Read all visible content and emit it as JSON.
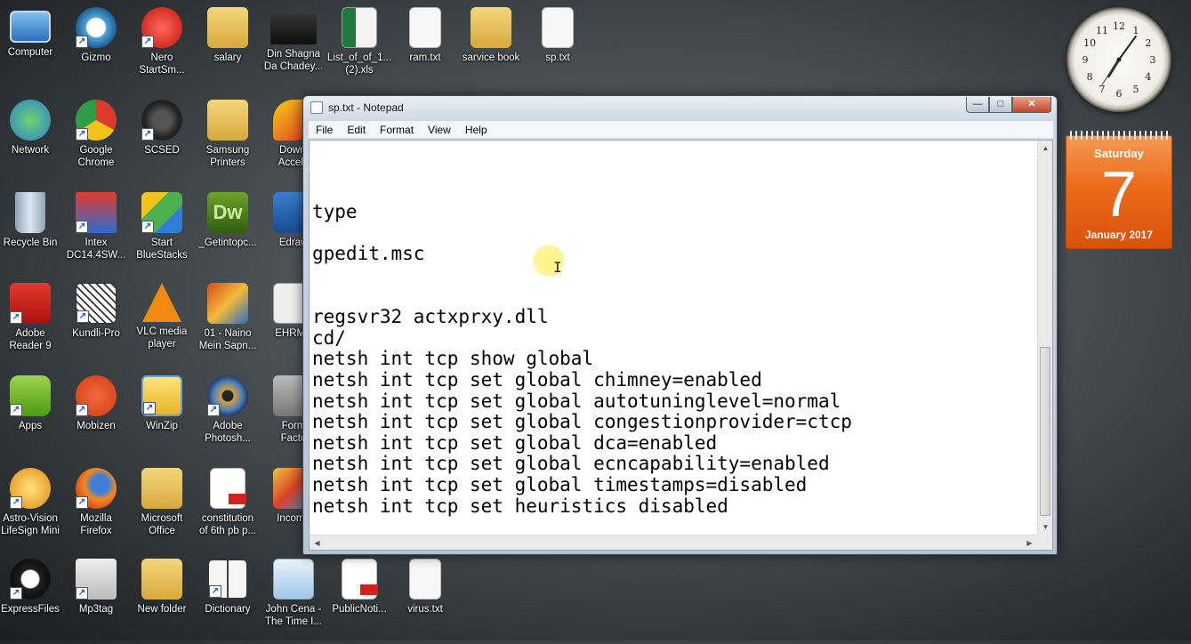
{
  "desktop": {
    "icons": [
      {
        "label": "Computer"
      },
      {
        "label": "Gizmo"
      },
      {
        "label": "Nero\nStartSm..."
      },
      {
        "label": "salary"
      },
      {
        "label": "Din Shagna\nDa Chadey..."
      },
      {
        "label": "List_of_of_1...\n(2).xls"
      },
      {
        "label": "ram.txt"
      },
      {
        "label": "sarvice book"
      },
      {
        "label": "sp.txt"
      },
      {
        "label": "Network"
      },
      {
        "label": "Google\nChrome"
      },
      {
        "label": "SCSED"
      },
      {
        "label": "Samsung\nPrinters"
      },
      {
        "label": "Downl\nAccele"
      },
      {
        "label": "Recycle Bin"
      },
      {
        "label": "Intex\nDC14.4SW..."
      },
      {
        "label": "Start\nBlueStacks"
      },
      {
        "label": "_Getintopc..."
      },
      {
        "label": "Edraw"
      },
      {
        "label": "Adobe\nReader 9"
      },
      {
        "label": "Kundli-Pro"
      },
      {
        "label": "VLC media\nplayer"
      },
      {
        "label": "01 - Naino\nMein Sapn..."
      },
      {
        "label": "EHRMS"
      },
      {
        "label": "Apps"
      },
      {
        "label": "Mobizen"
      },
      {
        "label": "WinZip"
      },
      {
        "label": "Adobe\nPhotosh..."
      },
      {
        "label": "Form\nFacto"
      },
      {
        "label": "Astro-Vision\nLifeSign Mini"
      },
      {
        "label": "Mozilla\nFirefox"
      },
      {
        "label": "Microsoft\nOffice"
      },
      {
        "label": "constitution\nof 6th pb p..."
      },
      {
        "label": "Income"
      },
      {
        "label": "ExpressFiles"
      },
      {
        "label": "Mp3tag"
      },
      {
        "label": "New folder"
      },
      {
        "label": "Dictionary"
      },
      {
        "label": "John Cena -\nThe Time I..."
      },
      {
        "label": "PublicNoti..."
      },
      {
        "label": "virus.txt"
      }
    ]
  },
  "notepad": {
    "title": "sp.txt - Notepad",
    "menu": [
      "File",
      "Edit",
      "Format",
      "View",
      "Help"
    ],
    "lines": [
      "",
      "",
      "type",
      "",
      "gpedit.msc",
      "",
      "",
      "regsvr32 actxprxy.dll",
      "cd/",
      "netsh int tcp show global",
      "netsh int tcp set global chimney=enabled",
      "netsh int tcp set global autotuninglevel=normal",
      "netsh int tcp set global congestionprovider=ctcp",
      "netsh int tcp set global dca=enabled",
      "netsh int tcp set global ecncapability=enabled",
      "netsh int tcp set global timestamps=disabled",
      "netsh int tcp set heuristics disabled"
    ]
  },
  "calendar": {
    "day": "Saturday",
    "date": "7",
    "month": "January 2017"
  },
  "clock": {
    "numerals": [
      "12",
      "1",
      "2",
      "3",
      "4",
      "5",
      "6",
      "7",
      "8",
      "9",
      "10",
      "11"
    ]
  }
}
